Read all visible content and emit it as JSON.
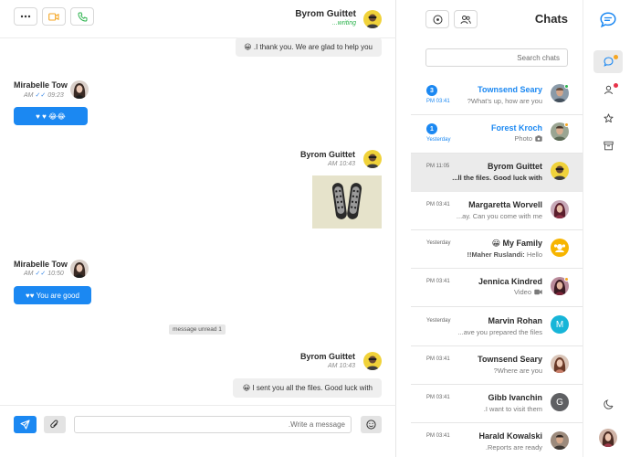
{
  "conversation": {
    "header": {
      "name": "Byrom Guittet",
      "status": "...writing"
    },
    "messages": [
      {
        "side": "right",
        "text": "😀 .I thank you. We are glad to help you"
      },
      {
        "side": "left",
        "sender": "Mirabelle Tow",
        "time": "09:23",
        "ampm": "AM",
        "ticks": "✓✓",
        "text": "♥ ♥ 😂😂"
      },
      {
        "side": "right",
        "sender": "Byrom Guittet",
        "time": "10:43",
        "ampm": "AM",
        "attachment": "sneakers-photo"
      },
      {
        "side": "left",
        "sender": "Mirabelle Tow",
        "time": "10:50",
        "ampm": "AM",
        "ticks": "✓✓",
        "text": "♥♥ You are good"
      },
      {
        "side": "right",
        "sender": "Byrom Guittet",
        "time": "10:43",
        "ampm": "AM",
        "text": "😀 I sent you all the files. Good luck with"
      }
    ],
    "unread_divider": "message unread 1",
    "composer": {
      "placeholder": ".Write a message",
      "value": ""
    }
  },
  "chat_list": {
    "title": "Chats",
    "search_placeholder": "Search chats",
    "items": [
      {
        "name": "Townsend Seary",
        "preview": "?What's up, how are you",
        "time": "PM 03:41",
        "unread": "3",
        "name_color": "blue",
        "status": "green"
      },
      {
        "name": "Forest Kroch",
        "preview": "Photo",
        "time": "Yesterday",
        "unread": "1",
        "name_color": "blue",
        "status": "orange",
        "preview_icon": "camera-icon"
      },
      {
        "name": "Byrom Guittet",
        "preview": "...ll the files. Good luck with",
        "time": "PM 11:05",
        "active": true,
        "bold_preview": true
      },
      {
        "name": "Margaretta Worvell",
        "preview": "...ay. Can you come with me",
        "time": "PM 03:41"
      },
      {
        "name": "My Family",
        "preview": "Hello",
        "preview_prefix": "!!Maher Ruslandi:",
        "time": "Yesterday",
        "emoji": "😀"
      },
      {
        "name": "Jennica Kindred",
        "preview": "Video",
        "time": "PM 03:41",
        "status": "orange",
        "preview_icon": "video-icon"
      },
      {
        "name": "Marvin Rohan",
        "preview": "...ave you prepared the files",
        "time": "Yesterday",
        "initial": "M"
      },
      {
        "name": "Townsend Seary",
        "preview": "?Where are you",
        "time": "PM 03:41"
      },
      {
        "name": "Gibb Ivanchin",
        "preview": ".I want to visit them",
        "time": "PM 03:41",
        "initial": "G"
      },
      {
        "name": "Harald Kowalski",
        "preview": ".Reports are ready",
        "time": "PM 03:41"
      }
    ]
  },
  "nav_rail": {
    "items": [
      "chats-icon",
      "friends-icon",
      "favorites-icon",
      "archive-icon"
    ],
    "bottom": [
      "dark-mode-icon",
      "profile-avatar"
    ]
  },
  "colors": {
    "accent": "#1b88f2",
    "online": "#2bb24c",
    "away": "#f5a623",
    "alert": "#e8334a"
  }
}
